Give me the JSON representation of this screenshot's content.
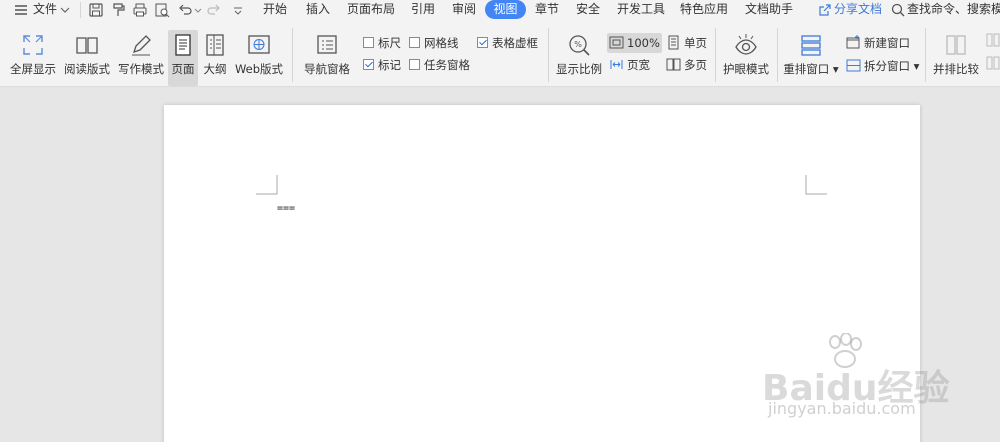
{
  "menubar": {
    "file_label": "文件",
    "tabs": [
      "开始",
      "插入",
      "页面布局",
      "引用",
      "审阅",
      "视图",
      "章节",
      "安全",
      "开发工具",
      "特色应用",
      "文档助手"
    ],
    "active_tab": "视图",
    "share_label": "分享文档",
    "search_label": "查找命令、搜索模"
  },
  "ribbon": {
    "fullscreen": "全屏显示",
    "read_mode": "阅读版式",
    "write_mode": "写作模式",
    "page_view": "页面",
    "outline": "大纲",
    "web_view": "Web版式",
    "nav_pane": "导航窗格",
    "ruler": "标尺",
    "gridlines": "网格线",
    "table_gridlines": "表格虚框",
    "marks": "标记",
    "task_pane": "任务窗格",
    "zoom_ratio": "显示比例",
    "zoom_value": "100%",
    "page_width": "页宽",
    "single_page": "单页",
    "multi_page": "多页",
    "eye_protect": "护眼模式",
    "rearrange": "重排窗口",
    "new_window": "新建窗口",
    "split_window": "拆分窗口",
    "side_by_side": "并排比较",
    "checks": {
      "ruler": false,
      "gridlines": false,
      "table_gridlines": true,
      "marks": true,
      "task_pane": false
    }
  },
  "document": {
    "text": "==="
  },
  "watermark": {
    "brand": "Baidu经验",
    "url": "jingyan.baidu.com"
  },
  "colors": {
    "accent": "#4285f4",
    "share": "#3e7ad9"
  }
}
